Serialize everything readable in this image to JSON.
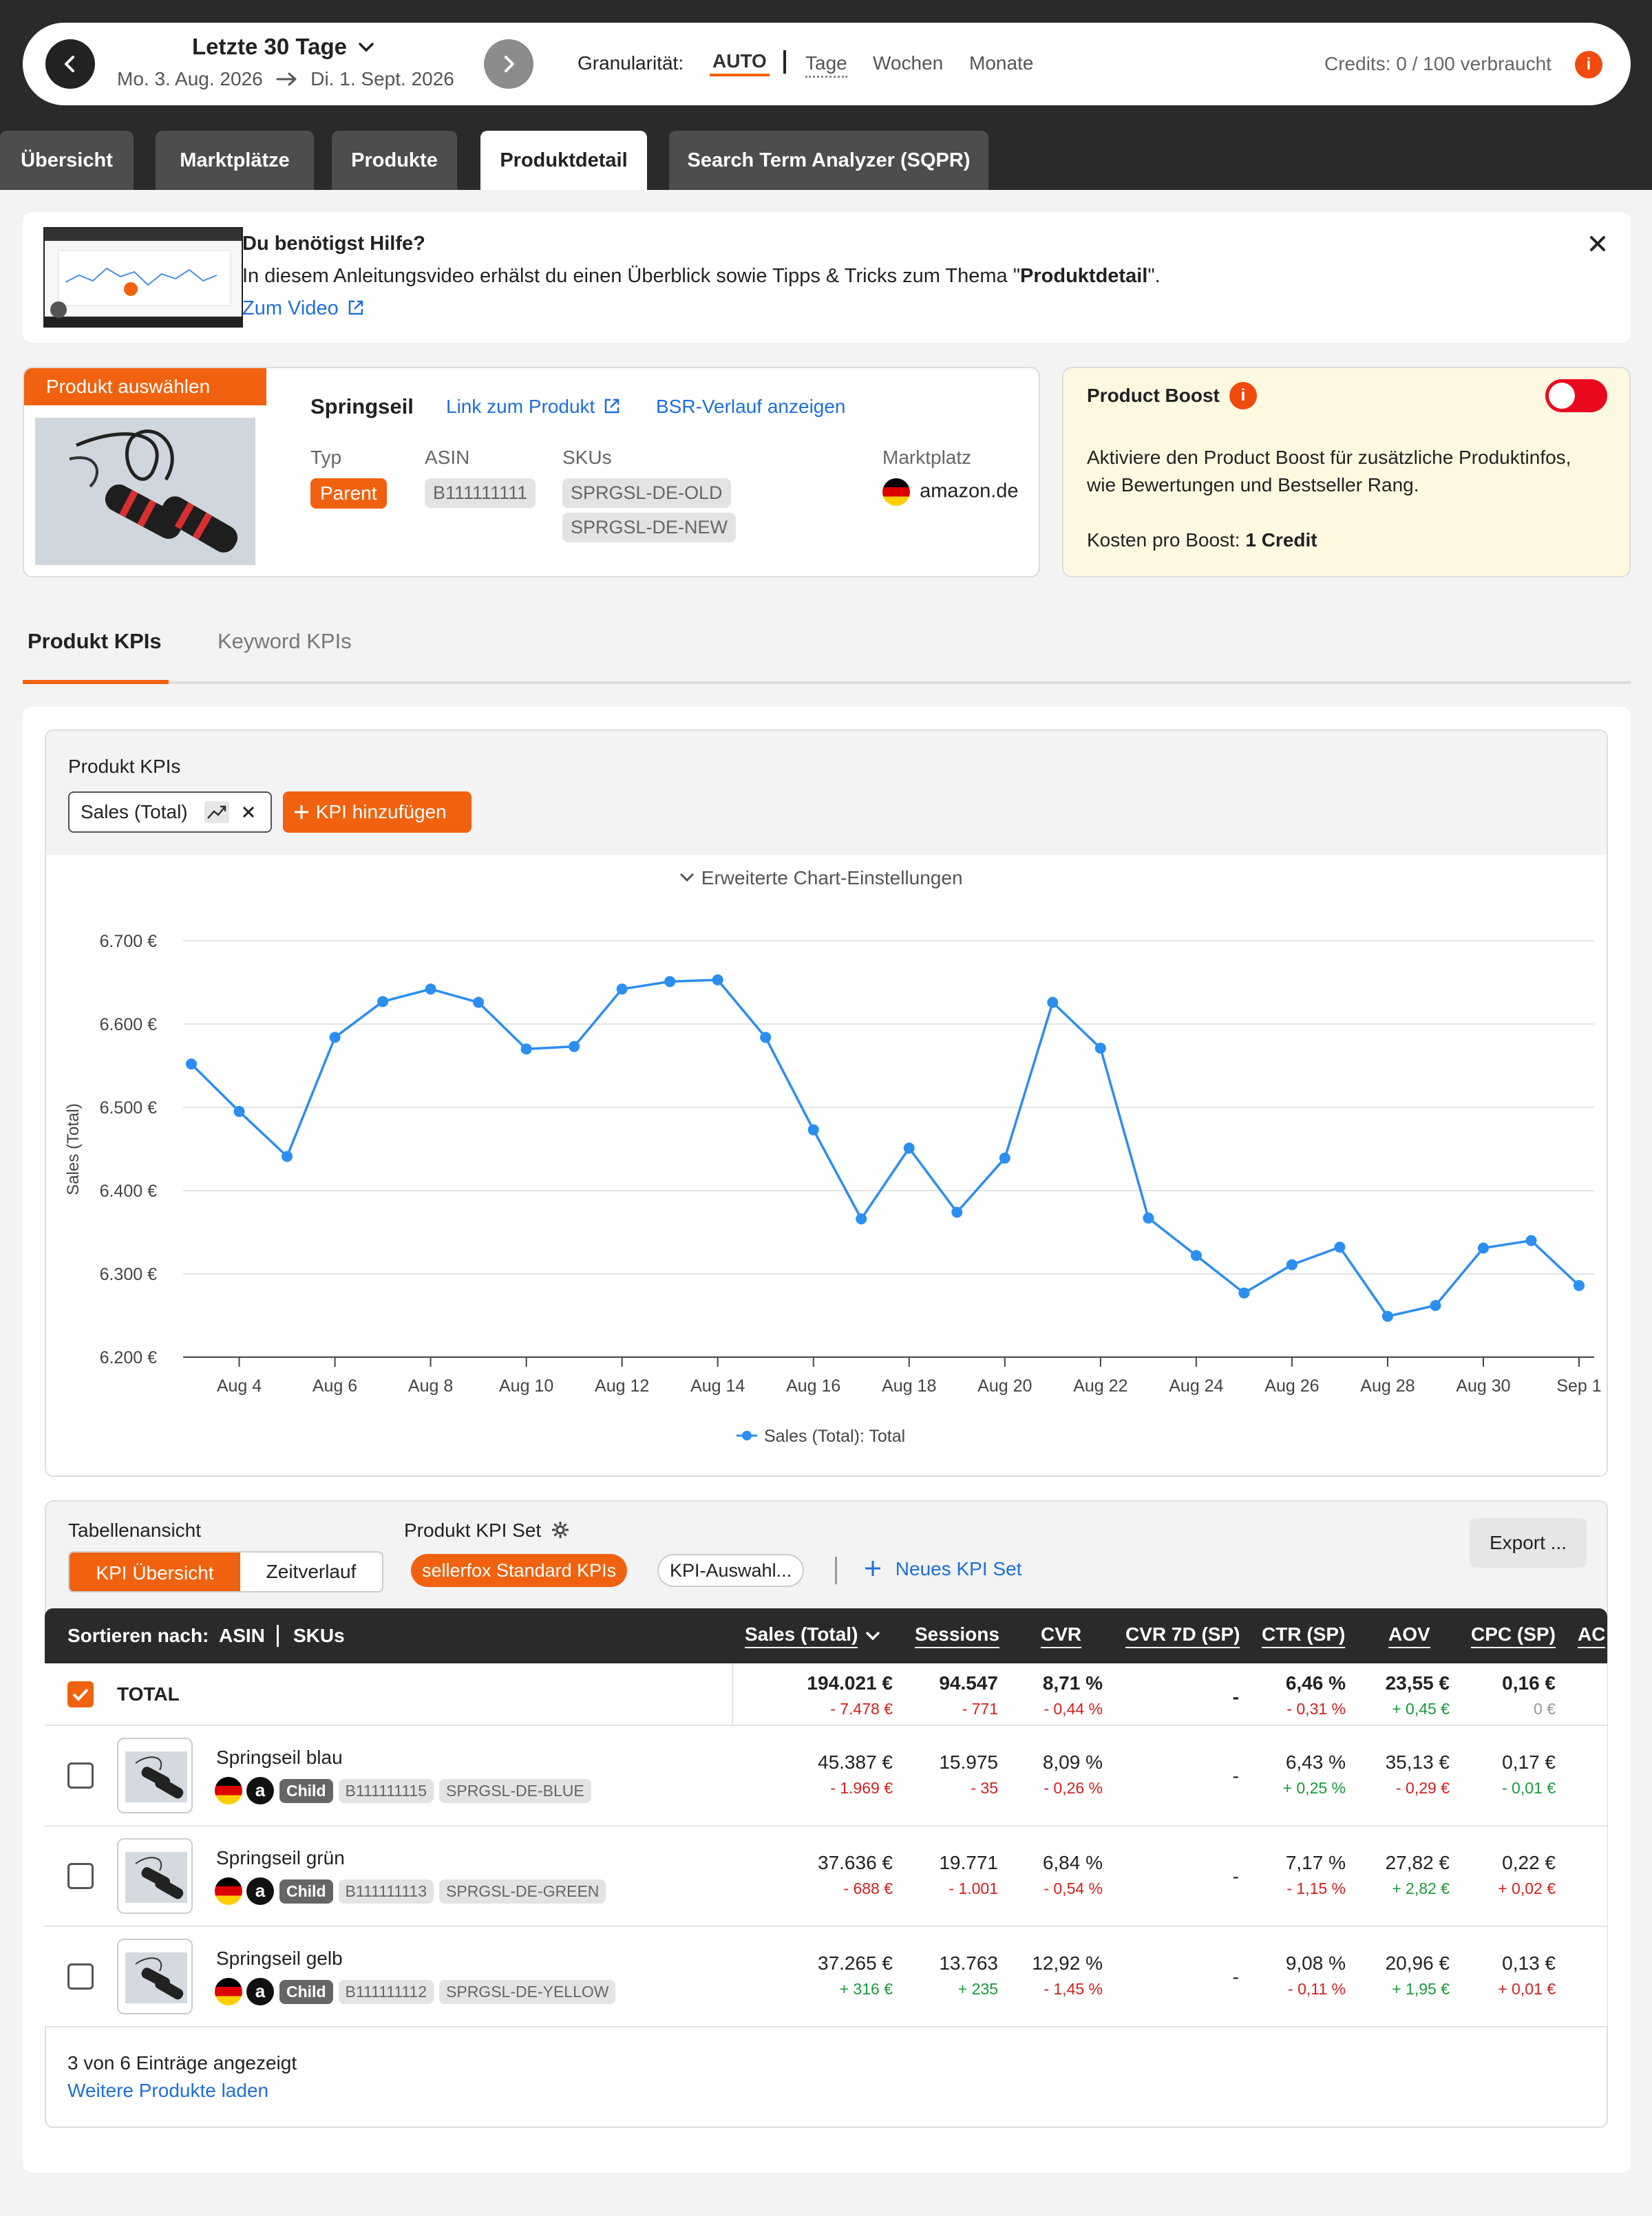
{
  "header": {
    "period_label": "Letzte 30 Tage",
    "range_start": "Mo. 3. Aug. 2026",
    "range_end": "Di. 1. Sept. 2026",
    "granularity_label": "Granularität:",
    "granularity_options": [
      "AUTO",
      "Tage",
      "Wochen",
      "Monate"
    ],
    "selected_granularity": "AUTO",
    "credits": "Credits: 0 / 100 verbraucht"
  },
  "nav_tabs": [
    "Übersicht",
    "Marktplätze",
    "Produkte",
    "Produktdetail",
    "Search Term Analyzer (SQPR)"
  ],
  "active_tab": "Produktdetail",
  "help": {
    "title": "Du benötigst Hilfe?",
    "text_before": "In diesem Anleitungsvideo erhälst du einen Überblick sowie Tipps & Tricks zum Thema \"",
    "text_bold": "Produktdetail",
    "text_after": "\".",
    "video_link": "Zum Video"
  },
  "product": {
    "select_label": "Produkt auswählen",
    "name": "Springseil",
    "link_label": "Link zum Produkt",
    "bsr_label": "BSR-Verlauf anzeigen",
    "type_header": "Typ",
    "type": "Parent",
    "asin_header": "ASIN",
    "asin": "B111111111",
    "skus_header": "SKUs",
    "skus": [
      "SPRGSL-DE-OLD",
      "SPRGSL-DE-NEW"
    ],
    "marketplace_header": "Marktplatz",
    "marketplace": "amazon.de"
  },
  "boost": {
    "title": "Product Boost",
    "text_line1": "Aktiviere den Product Boost für zusätzliche Produktinfos,",
    "text_line2": "wie Bewertungen und Bestseller Rang.",
    "cost_label": "Kosten pro Boost:",
    "cost_value": "1 Credit",
    "enabled": false
  },
  "kpi_tabs": [
    "Produkt KPIs",
    "Keyword KPIs"
  ],
  "active_kpi_tab": "Produkt KPIs",
  "chart_panel": {
    "title": "Produkt KPIs",
    "kpi_chip": "Sales (Total)",
    "add_kpi": "KPI hinzufügen",
    "advanced": "Erweiterte Chart-Einstellungen"
  },
  "chart_data": {
    "type": "line",
    "title": "",
    "xlabel": "",
    "ylabel": "Sales (Total)",
    "ylim": [
      6200,
      6700
    ],
    "y_ticks": [
      "6.200 €",
      "6.300 €",
      "6.400 €",
      "6.500 €",
      "6.600 €",
      "6.700 €"
    ],
    "x_ticks": [
      "Aug 4",
      "Aug 6",
      "Aug 8",
      "Aug 10",
      "Aug 12",
      "Aug 14",
      "Aug 16",
      "Aug 18",
      "Aug 20",
      "Aug 22",
      "Aug 24",
      "Aug 26",
      "Aug 28",
      "Aug 30",
      "Sep 1"
    ],
    "x": [
      "Aug 3",
      "Aug 4",
      "Aug 5",
      "Aug 6",
      "Aug 7",
      "Aug 8",
      "Aug 9",
      "Aug 10",
      "Aug 11",
      "Aug 12",
      "Aug 13",
      "Aug 14",
      "Aug 15",
      "Aug 16",
      "Aug 17",
      "Aug 18",
      "Aug 19",
      "Aug 20",
      "Aug 21",
      "Aug 22",
      "Aug 23",
      "Aug 24",
      "Aug 25",
      "Aug 26",
      "Aug 27",
      "Aug 28",
      "Aug 29",
      "Aug 30",
      "Aug 31",
      "Sep 1"
    ],
    "series": [
      {
        "name": "Sales (Total): Total",
        "color": "#2b8ef0",
        "values": [
          6552,
          6495,
          6441,
          6584,
          6627,
          6642,
          6626,
          6570,
          6573,
          6642,
          6651,
          6653,
          6584,
          6473,
          6366,
          6451,
          6374,
          6439,
          6626,
          6571,
          6367,
          6322,
          6277,
          6311,
          6332,
          6249,
          6262,
          6331,
          6340,
          6286
        ]
      }
    ],
    "grid": true,
    "legend": "bottom"
  },
  "table_panel": {
    "view_label": "Tabellenansicht",
    "views": [
      "KPI Übersicht",
      "Zeitverlauf"
    ],
    "active_view": "KPI Übersicht",
    "kpi_set_label": "Produkt KPI Set",
    "kpi_sets": [
      "sellerfox Standard KPIs",
      "KPI-Auswahl..."
    ],
    "new_set": "Neues KPI Set",
    "export": "Export ...",
    "sort_label": "Sortieren nach:",
    "sort_options": [
      "ASIN",
      "SKUs"
    ],
    "columns": [
      "Sales (Total)",
      "Sessions",
      "CVR",
      "CVR 7D (SP)",
      "CTR (SP)",
      "AOV",
      "CPC (SP)",
      "AC"
    ],
    "total": {
      "label": "TOTAL",
      "values": [
        "194.021 €",
        "94.547",
        "8,71 %",
        "-",
        "6,46 %",
        "23,55 €",
        "0,16 €"
      ],
      "deltas": [
        "- 7.478 €",
        "- 771",
        "- 0,44 %",
        "",
        "- 0,31 %",
        "+ 0,45 €",
        "0 €"
      ],
      "delta_dir": [
        "neg",
        "neg",
        "neg",
        "",
        "neg",
        "pos",
        "zer"
      ]
    },
    "rows": [
      {
        "name": "Springseil blau",
        "badge": "Child",
        "asin": "B111111115",
        "sku": "SPRGSL-DE-BLUE",
        "values": [
          "45.387 €",
          "15.975",
          "8,09 %",
          "-",
          "6,43 %",
          "35,13 €",
          "0,17 €"
        ],
        "deltas": [
          "- 1.969 €",
          "- 35",
          "- 0,26 %",
          "",
          "+ 0,25 %",
          "- 0,29 €",
          "- 0,01 €"
        ],
        "delta_dir": [
          "neg",
          "neg",
          "neg",
          "",
          "pos",
          "neg",
          "pos"
        ]
      },
      {
        "name": "Springseil grün",
        "badge": "Child",
        "asin": "B111111113",
        "sku": "SPRGSL-DE-GREEN",
        "values": [
          "37.636 €",
          "19.771",
          "6,84 %",
          "-",
          "7,17 %",
          "27,82 €",
          "0,22 €"
        ],
        "deltas": [
          "- 688 €",
          "- 1.001",
          "- 0,54 %",
          "",
          "- 1,15 %",
          "+ 2,82 €",
          "+ 0,02 €"
        ],
        "delta_dir": [
          "neg",
          "neg",
          "neg",
          "",
          "neg",
          "pos",
          "neg"
        ]
      },
      {
        "name": "Springseil gelb",
        "badge": "Child",
        "asin": "B111111112",
        "sku": "SPRGSL-DE-YELLOW",
        "values": [
          "37.265 €",
          "13.763",
          "12,92 %",
          "-",
          "9,08 %",
          "20,96 €",
          "0,13 €"
        ],
        "deltas": [
          "+ 316 €",
          "+ 235",
          "- 1,45 %",
          "",
          "- 0,11 %",
          "+ 1,95 €",
          "+ 0,01 €"
        ],
        "delta_dir": [
          "pos",
          "pos",
          "neg",
          "",
          "neg",
          "pos",
          "neg"
        ]
      }
    ],
    "count_text": "3 von 6 Einträge angezeigt",
    "load_more": "Weitere Produkte laden"
  }
}
